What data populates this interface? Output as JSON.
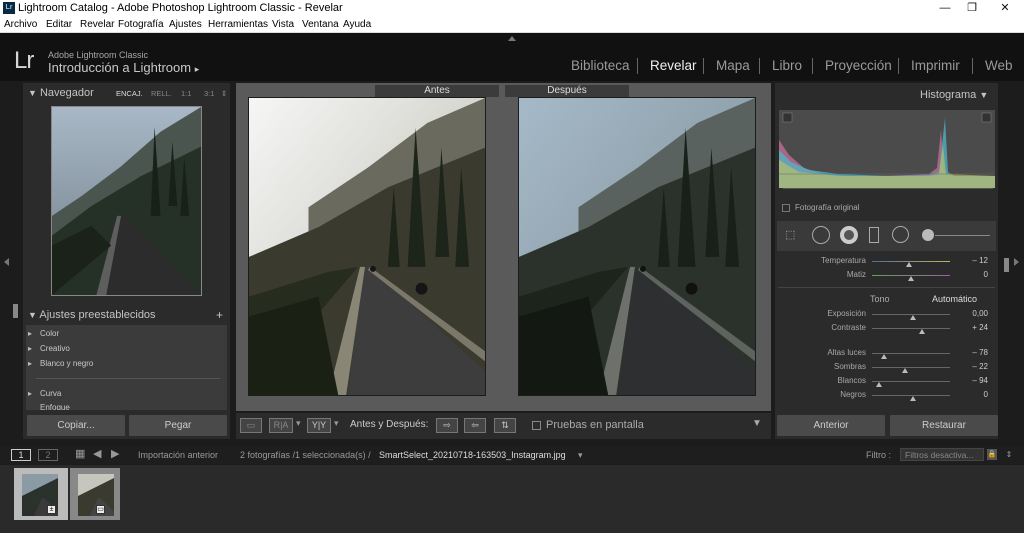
{
  "window": {
    "title": "Lightroom Catalog - Adobe Photoshop Lightroom Classic - Revelar",
    "minimize": "—",
    "maximize": "❐",
    "close": "✕"
  },
  "menu": [
    "Archivo",
    "Editar",
    "Revelar",
    "Fotografía",
    "Ajustes",
    "Herramientas",
    "Vista",
    "Ventana",
    "Ayuda"
  ],
  "identity": {
    "logo": "Lr",
    "subtitle": "Adobe Lightroom Classic",
    "catalog": "Introducción a Lightroom",
    "catalog_arrow": "▸"
  },
  "modules": [
    "Biblioteca",
    "Revelar",
    "Mapa",
    "Libro",
    "Proyección",
    "Imprimir",
    "Web"
  ],
  "active_module": "Revelar",
  "navigator": {
    "title": "Navegador",
    "options": [
      "ENCAJ.",
      "RELL.",
      "1:1",
      "3:1"
    ],
    "active_option": "ENCAJ."
  },
  "presets": {
    "title": "Ajustes preestablecidos",
    "add": "+",
    "items": [
      "Color",
      "Creativo",
      "Blanco y negro",
      "Curva",
      "Enfoque"
    ]
  },
  "left_buttons": {
    "copy": "Copiar...",
    "paste": "Pegar"
  },
  "compare": {
    "before": "Antes",
    "after": "Después"
  },
  "toolbar": {
    "view_label": "Antes y Después:",
    "proof_label": "Pruebas en pantalla",
    "ra": "R|A",
    "yy": "Y|Y"
  },
  "histogram": {
    "title": "Histograma",
    "original_photo": "Fotografía original"
  },
  "basic": {
    "temp_label": "Temperatura",
    "temp_value": "– 12",
    "tint_label": "Matiz",
    "tint_value": "0",
    "tone_label": "Tono",
    "auto_label": "Automático",
    "exposure_label": "Exposición",
    "exposure_value": "0,00",
    "contrast_label": "Contraste",
    "contrast_value": "+ 24",
    "highlights_label": "Altas luces",
    "highlights_value": "– 78",
    "shadows_label": "Sombras",
    "shadows_value": "– 22",
    "whites_label": "Blancos",
    "whites_value": "– 94",
    "blacks_label": "Negros",
    "blacks_value": "0"
  },
  "right_buttons": {
    "previous": "Anterior",
    "reset": "Restaurar"
  },
  "filmstrip": {
    "page1": "1",
    "page2": "2",
    "source": "Importación anterior",
    "count": "2 fotografías /1 seleccionada(s) /",
    "filename": "SmartSelect_20210718-163503_Instagram.jpg",
    "filter_label": "Filtro :",
    "filter_value": "Filtros desactiva..."
  },
  "colors": {
    "accent": "#f0f0f0",
    "panel": "#2b2b2b",
    "bg": "#1c1c1c"
  }
}
